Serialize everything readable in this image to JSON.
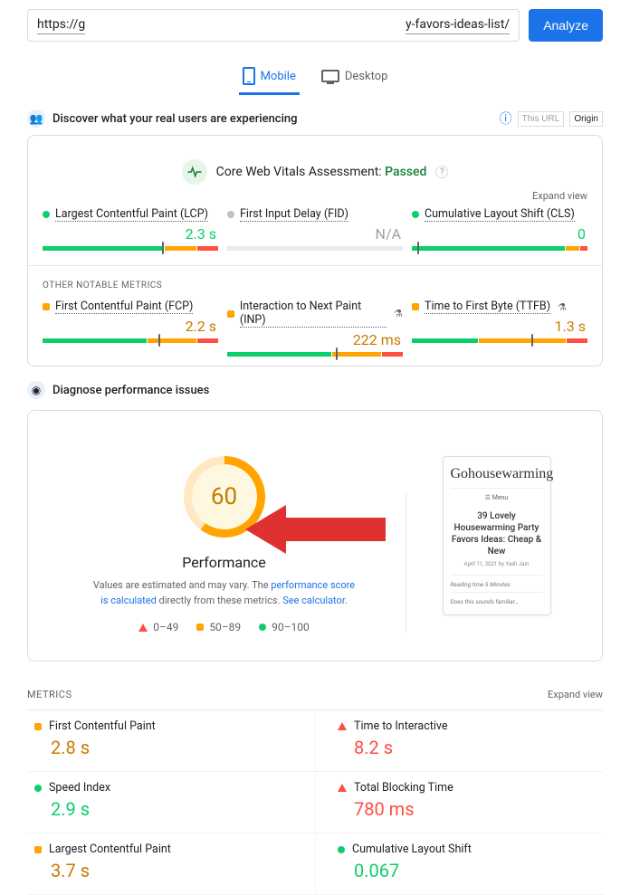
{
  "topbar": {
    "url_prefix": "https://g",
    "url_suffix": "y-favors-ideas-list/",
    "analyze_label": "Analyze"
  },
  "tabs": {
    "mobile": "Mobile",
    "desktop": "Desktop"
  },
  "discover": {
    "heading": "Discover what your real users are experiencing",
    "seg_this_url": "This URL",
    "seg_origin": "Origin"
  },
  "cwv": {
    "prefix": "Core Web Vitals Assessment:",
    "status": "Passed",
    "expand": "Expand view",
    "other_label": "OTHER NOTABLE METRICS",
    "metrics_top": [
      {
        "name": "Largest Contentful Paint (LCP)",
        "value": "2.3 s",
        "status": "green",
        "bar": [
          70,
          18,
          12
        ],
        "marker": 68
      },
      {
        "name": "First Input Delay (FID)",
        "value": "N/A",
        "status": "gray",
        "bar": [
          100
        ],
        "gray": true
      },
      {
        "name": "Cumulative Layout Shift (CLS)",
        "value": "0",
        "status": "green",
        "bar": [
          88,
          8,
          4
        ],
        "marker": 3
      }
    ],
    "metrics_other": [
      {
        "name": "First Contentful Paint (FCP)",
        "value": "2.2 s",
        "status": "orange",
        "bar": [
          60,
          28,
          12
        ],
        "marker": 66
      },
      {
        "name": "Interaction to Next Paint (INP)",
        "value": "222 ms",
        "status": "orange",
        "bar": [
          60,
          28,
          12
        ],
        "marker": 62,
        "flask": true
      },
      {
        "name": "Time to First Byte (TTFB)",
        "value": "1.3 s",
        "status": "orange",
        "bar": [
          38,
          50,
          12
        ],
        "marker": 68,
        "flask": true
      }
    ]
  },
  "diagnose": {
    "heading": "Diagnose performance issues",
    "score": "60",
    "label": "Performance",
    "note_1": "Values are estimated and may vary. The ",
    "note_link1": "performance score is calculated",
    "note_2": " directly from these metrics. ",
    "note_link2": "See calculator",
    "legend": {
      "low": "0–49",
      "mid": "50–89",
      "high": "90–100"
    },
    "preview": {
      "brand": "Gohousewarming",
      "menu": "☰ Menu",
      "title": "39 Lovely Housewarming Party Favors Ideas: Cheap & New",
      "meta": "April 11, 2021 by Yash Jain",
      "line1": "Reading time 5 Minutes",
      "line2": "Does this sounds familiar…"
    }
  },
  "metrics": {
    "header": "METRICS",
    "expand": "Expand view",
    "items": [
      {
        "name": "First Contentful Paint",
        "value": "2.8 s",
        "status": "orange"
      },
      {
        "name": "Time to Interactive",
        "value": "8.2 s",
        "status": "red"
      },
      {
        "name": "Speed Index",
        "value": "2.9 s",
        "status": "green"
      },
      {
        "name": "Total Blocking Time",
        "value": "780 ms",
        "status": "red"
      },
      {
        "name": "Largest Contentful Paint",
        "value": "3.7 s",
        "status": "orange"
      },
      {
        "name": "Cumulative Layout Shift",
        "value": "0.067",
        "status": "green"
      }
    ]
  }
}
